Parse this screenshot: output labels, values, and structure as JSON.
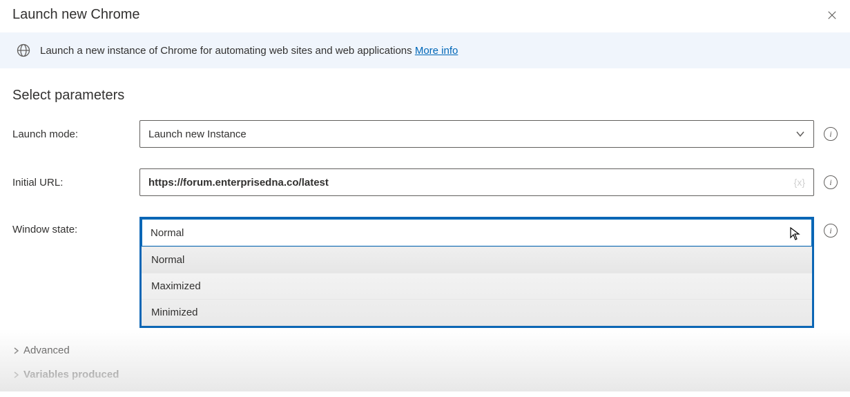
{
  "title": "Launch new Chrome",
  "banner": {
    "text": "Launch a new instance of Chrome for automating web sites and web applications",
    "link": "More info"
  },
  "section_heading": "Select parameters",
  "fields": {
    "launch_mode": {
      "label": "Launch mode:",
      "value": "Launch new Instance"
    },
    "initial_url": {
      "label": "Initial URL:",
      "value": "https://forum.enterprisedna.co/latest",
      "chip": "{x}"
    },
    "window_state": {
      "label": "Window state:",
      "selected": "Normal",
      "options": [
        "Normal",
        "Maximized",
        "Minimized"
      ]
    }
  },
  "collapsibles": {
    "advanced": "Advanced",
    "variables": "Variables produced"
  }
}
